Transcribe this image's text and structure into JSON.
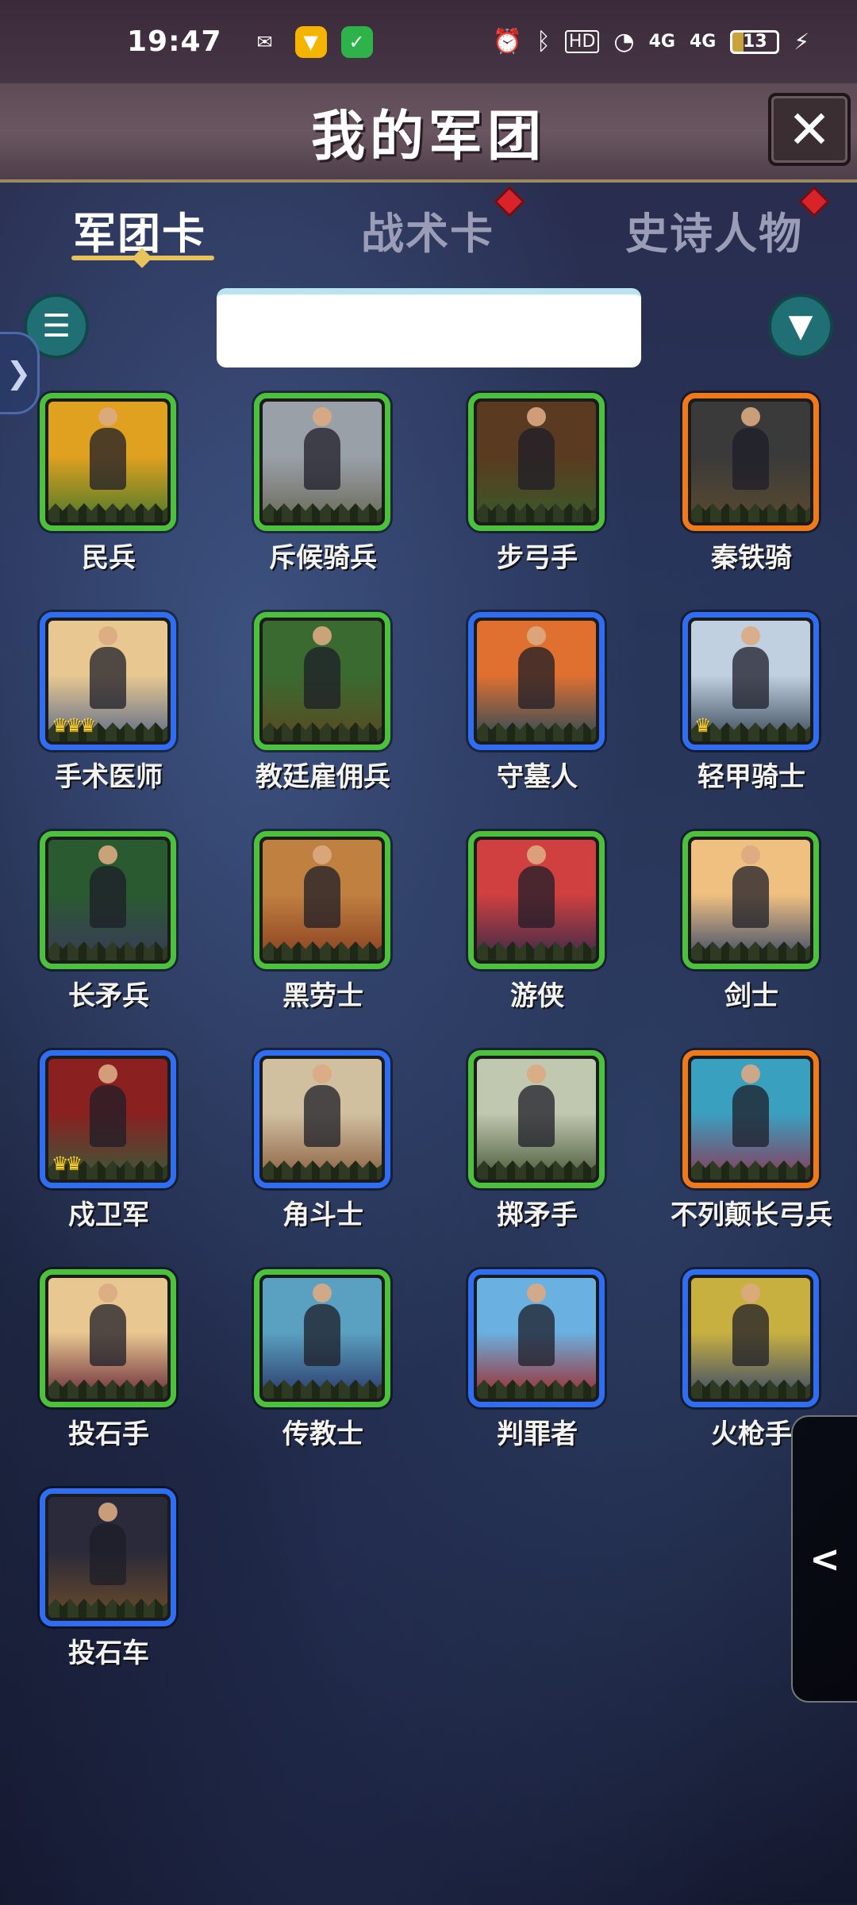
{
  "status_bar": {
    "time": "19:47",
    "apps": [
      {
        "icon": "wechat-icon",
        "glyph": "✉",
        "color": "#ffffff",
        "bg": "transparent"
      },
      {
        "icon": "vpn-shield-icon",
        "glyph": "▼",
        "color": "#ffffff",
        "bg": "#f4b400"
      },
      {
        "icon": "security-shield-icon",
        "glyph": "✓",
        "color": "#ffffff",
        "bg": "#2db34a"
      }
    ],
    "right": {
      "alarm": "⏰",
      "bluetooth": "ᛒ",
      "hd": "HD",
      "wifi": "◔",
      "signal1": "4G",
      "signal2": "4G",
      "battery": "13",
      "charging": "⚡"
    }
  },
  "header": {
    "title": "我的军团",
    "close_label": "✕"
  },
  "tabs": [
    {
      "label": "军团卡",
      "active": true,
      "badge": false
    },
    {
      "label": "战术卡",
      "active": false,
      "badge": true
    },
    {
      "label": "史诗人物",
      "active": false,
      "badge": true
    }
  ],
  "toolbar": {
    "list_icon": "☰",
    "filter_icon": "▼",
    "search_value": "",
    "search_placeholder": ""
  },
  "side_handle": "❯",
  "drawer_handle": "<",
  "cards": [
    {
      "name": "民兵",
      "rarity": "green",
      "crowns": 0,
      "sky": "#e0a020",
      "ground": "#4a7a2a"
    },
    {
      "name": "斥候骑兵",
      "rarity": "green",
      "crowns": 0,
      "sky": "#9aa0a8",
      "ground": "#6a6a5a"
    },
    {
      "name": "步弓手",
      "rarity": "green",
      "crowns": 0,
      "sky": "#5a3a20",
      "ground": "#3a5a2a"
    },
    {
      "name": "秦铁骑",
      "rarity": "orange",
      "crowns": 0,
      "sky": "#3a3a3a",
      "ground": "#5a4a30"
    },
    {
      "name": "手术医师",
      "rarity": "blue",
      "crowns": 3,
      "sky": "#e8c890",
      "ground": "#5a6a8a"
    },
    {
      "name": "教廷雇佣兵",
      "rarity": "green",
      "crowns": 0,
      "sky": "#3a6a30",
      "ground": "#5a4a20"
    },
    {
      "name": "守墓人",
      "rarity": "blue",
      "crowns": 0,
      "sky": "#e07030",
      "ground": "#2a4a5a"
    },
    {
      "name": "轻甲骑士",
      "rarity": "blue",
      "crowns": 1,
      "sky": "#c0d0e0",
      "ground": "#3a4a5a"
    },
    {
      "name": "长矛兵",
      "rarity": "green",
      "crowns": 0,
      "sky": "#2a5a30",
      "ground": "#3a3a5a"
    },
    {
      "name": "黑劳士",
      "rarity": "green",
      "crowns": 0,
      "sky": "#c08040",
      "ground": "#8a4020"
    },
    {
      "name": "游侠",
      "rarity": "green",
      "crowns": 0,
      "sky": "#d04040",
      "ground": "#3a2a4a"
    },
    {
      "name": "剑士",
      "rarity": "green",
      "crowns": 0,
      "sky": "#f0c080",
      "ground": "#3a4a6a"
    },
    {
      "name": "戍卫军",
      "rarity": "blue",
      "crowns": 2,
      "sky": "#8a2020",
      "ground": "#3a5a3a"
    },
    {
      "name": "角斗士",
      "rarity": "blue",
      "crowns": 0,
      "sky": "#d0c0a0",
      "ground": "#8a6040"
    },
    {
      "name": "掷矛手",
      "rarity": "green",
      "crowns": 0,
      "sky": "#c0c8b0",
      "ground": "#4a5a3a"
    },
    {
      "name": "不列颠长弓兵",
      "rarity": "orange",
      "crowns": 0,
      "sky": "#3aa0c0",
      "ground": "#8a3a5a"
    },
    {
      "name": "投石手",
      "rarity": "green",
      "crowns": 0,
      "sky": "#e8c890",
      "ground": "#6a2a3a"
    },
    {
      "name": "传教士",
      "rarity": "green",
      "crowns": 0,
      "sky": "#5aa0c0",
      "ground": "#2a3a6a"
    },
    {
      "name": "判罪者",
      "rarity": "blue",
      "crowns": 0,
      "sky": "#6ab0e0",
      "ground": "#a02a2a"
    },
    {
      "name": "火枪手",
      "rarity": "blue",
      "crowns": 0,
      "sky": "#c8b040",
      "ground": "#3a4a6a"
    },
    {
      "name": "投石车",
      "rarity": "blue",
      "crowns": 0,
      "sky": "#2a2a3a",
      "ground": "#6a4a2a"
    }
  ],
  "colors": {
    "green": "#4cc13b",
    "blue": "#2f6ef2",
    "orange": "#f07a1a",
    "accent_gold": "#e8c25a",
    "badge_red": "#d8232a"
  }
}
